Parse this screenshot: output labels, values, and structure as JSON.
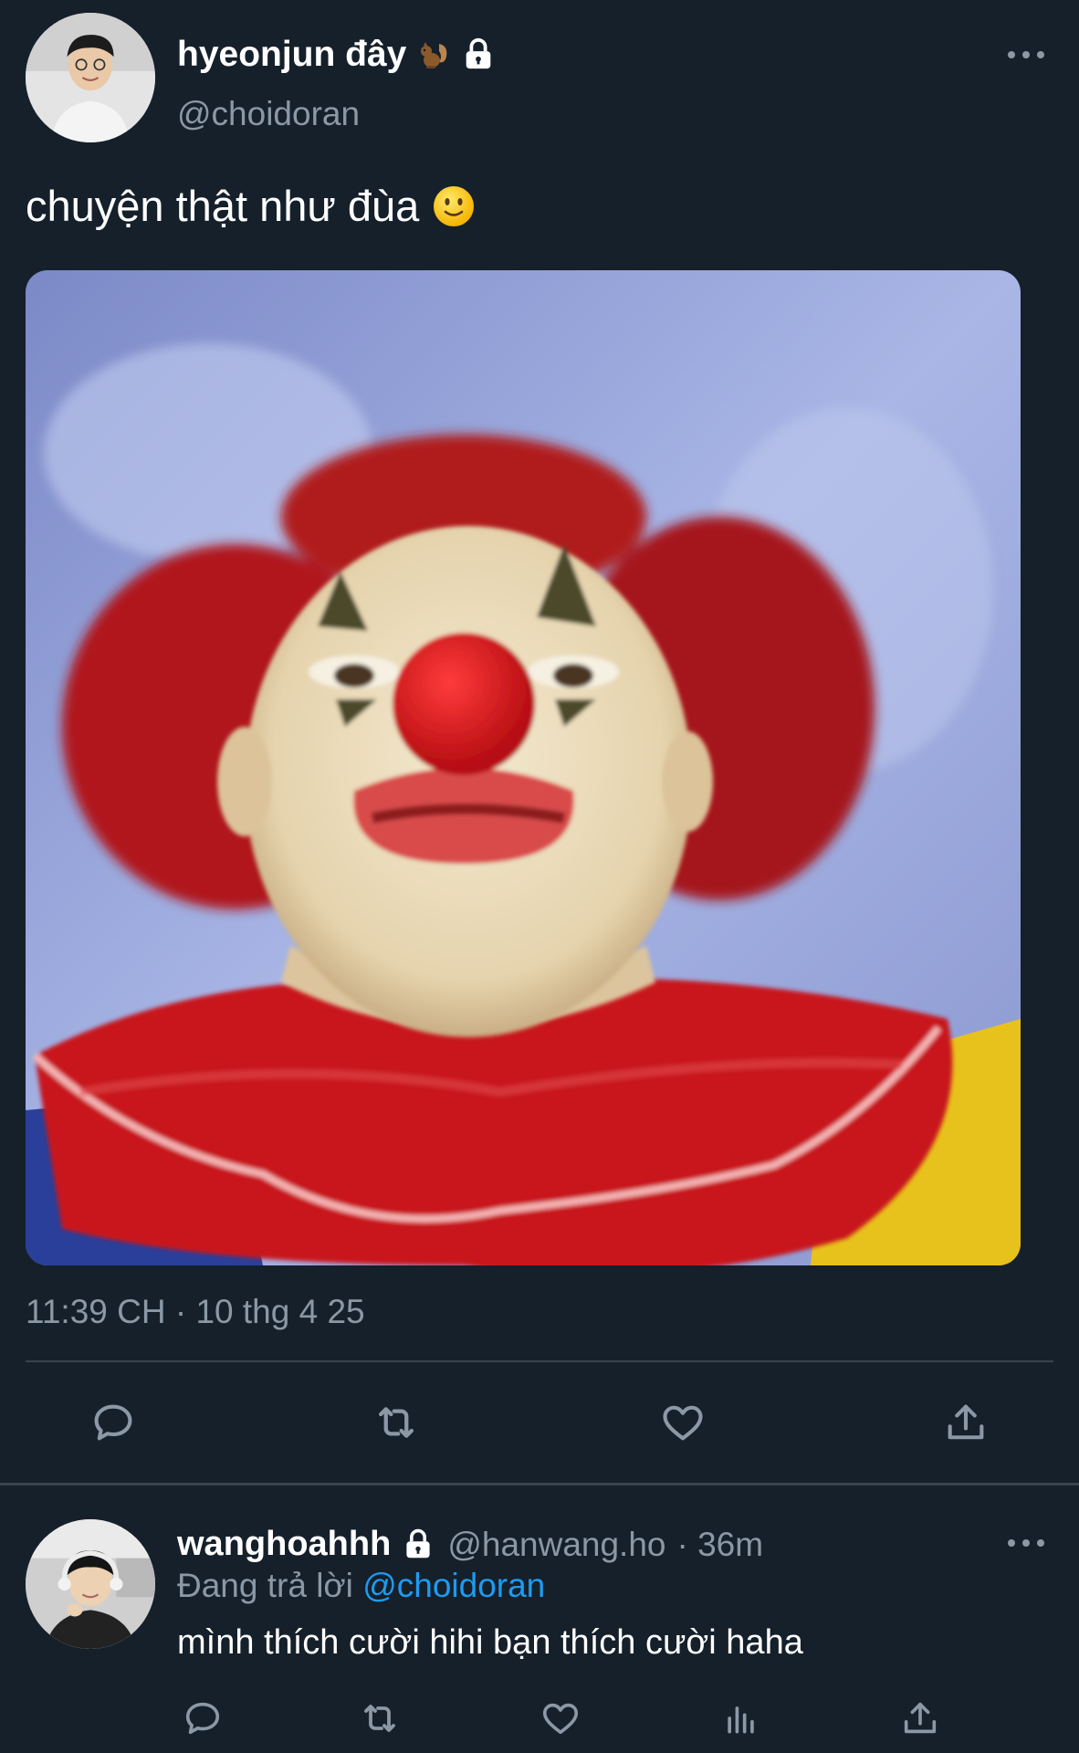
{
  "tweet": {
    "author": {
      "display_name": "hyeonjun đây",
      "handle": "@choidoran",
      "badges": [
        "squirrel-emoji",
        "lock-icon"
      ]
    },
    "text": "chuyện thật như đùa",
    "text_emoji": "slightly-smiling-face",
    "timestamp": "11:39 CH · 10 thg 4 25",
    "actions": [
      "reply-icon",
      "retweet-icon",
      "like-icon",
      "share-icon"
    ]
  },
  "reply": {
    "display_name": "wanghoahhh",
    "handle": "@hanwang.ho",
    "age": "· 36m",
    "replying_prefix": "Đang trả lời",
    "replying_to": "@choidoran",
    "text": "mình thích cười hihi bạn thích cười haha",
    "actions": [
      "reply-icon",
      "retweet-icon",
      "like-icon",
      "views-icon",
      "share-icon"
    ]
  },
  "colors": {
    "background": "#15202b",
    "text": "#ffffff",
    "secondary": "#8b98a5",
    "link": "#1d9bf0",
    "divider": "#38444d"
  }
}
